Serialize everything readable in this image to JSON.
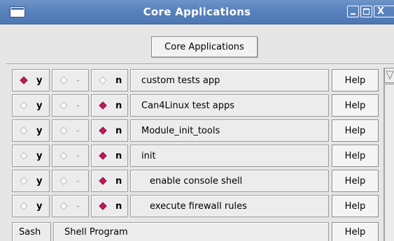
{
  "window": {
    "title": "Core Applications",
    "controls": [
      "minimize-icon",
      "maximize-icon",
      "close-icon"
    ]
  },
  "header_button": "Core Applications",
  "rows": [
    {
      "y_label": "y",
      "m_label": "-",
      "n_label": "n",
      "selected": "y",
      "name": "custom tests app",
      "indent": false,
      "help": "Help"
    },
    {
      "y_label": "y",
      "m_label": "-",
      "n_label": "n",
      "selected": "n",
      "name": "Can4Linux test apps",
      "indent": false,
      "help": "Help"
    },
    {
      "y_label": "y",
      "m_label": "-",
      "n_label": "n",
      "selected": "n",
      "name": "Module_init_tools",
      "indent": false,
      "help": "Help"
    },
    {
      "y_label": "y",
      "m_label": "-",
      "n_label": "n",
      "selected": "n",
      "name": "init",
      "indent": false,
      "help": "Help"
    },
    {
      "y_label": "y",
      "m_label": "-",
      "n_label": "n",
      "selected": "n",
      "name": "enable console shell",
      "indent": true,
      "help": "Help"
    },
    {
      "y_label": "y",
      "m_label": "-",
      "n_label": "n",
      "selected": "n",
      "name": "execute firewall rules",
      "indent": true,
      "help": "Help"
    }
  ],
  "last_row": {
    "choice": "Sash",
    "name": "Shell Program",
    "help": "Help"
  },
  "colors": {
    "titlebar": "#5882bd",
    "selected_diamond": "#c2185b"
  }
}
